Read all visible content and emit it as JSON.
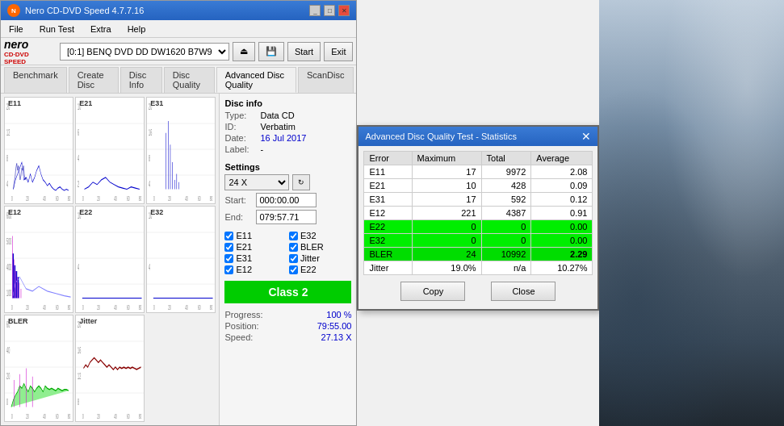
{
  "titleBar": {
    "title": "Nero CD-DVD Speed 4.7.7.16",
    "controls": [
      "minimize",
      "maximize",
      "close"
    ]
  },
  "menu": {
    "items": [
      "File",
      "Run Test",
      "Extra",
      "Help"
    ]
  },
  "toolbar": {
    "logo": "nero",
    "logoSub": "CD·DVD SPEED",
    "driveLabel": "[0:1]  BENQ DVD DD DW1620 B7W9",
    "startLabel": "Start",
    "stopLabel": "Exit"
  },
  "tabs": [
    {
      "label": "Benchmark"
    },
    {
      "label": "Create Disc"
    },
    {
      "label": "Disc Info"
    },
    {
      "label": "Disc Quality"
    },
    {
      "label": "Advanced Disc Quality",
      "active": true
    },
    {
      "label": "ScanDisc"
    }
  ],
  "charts": [
    {
      "id": "E11",
      "label": "E11",
      "maxY": 20
    },
    {
      "id": "E21",
      "label": "E21",
      "maxY": 10
    },
    {
      "id": "E31",
      "label": "E31",
      "maxY": 20
    },
    {
      "id": "E12",
      "label": "E12",
      "maxY": 600
    },
    {
      "id": "E22",
      "label": "E22",
      "maxY": 10
    },
    {
      "id": "E32",
      "label": "E32",
      "maxY": 10
    },
    {
      "id": "BLER",
      "label": "BLER",
      "maxY": 60
    },
    {
      "id": "Jitter",
      "label": "Jitter",
      "maxY": 20
    }
  ],
  "discInfo": {
    "sectionTitle": "Disc info",
    "typeLabel": "Type:",
    "typeValue": "Data CD",
    "idLabel": "ID:",
    "idValue": "Verbatim",
    "dateLabel": "Date:",
    "dateValue": "16 Jul 2017",
    "labelLabel": "Label:",
    "labelValue": "-"
  },
  "settings": {
    "sectionTitle": "Settings",
    "speedValue": "24 X",
    "startLabel": "Start:",
    "startValue": "000:00.00",
    "endLabel": "End:",
    "endValue": "079:57.71"
  },
  "checkboxes": [
    {
      "id": "E11",
      "label": "E11",
      "checked": true
    },
    {
      "id": "E32",
      "label": "E32",
      "checked": true
    },
    {
      "id": "E21",
      "label": "E21",
      "checked": true
    },
    {
      "id": "BLER",
      "label": "BLER",
      "checked": true
    },
    {
      "id": "E31",
      "label": "E31",
      "checked": true
    },
    {
      "id": "Jitter",
      "label": "Jitter",
      "checked": true
    },
    {
      "id": "E12",
      "label": "E12",
      "checked": true
    },
    {
      "id": "E22",
      "label": "E22",
      "checked": true
    }
  ],
  "classBox": {
    "label": "Class 2"
  },
  "progress": {
    "progressLabel": "Progress:",
    "progressValue": "100 %",
    "positionLabel": "Position:",
    "positionValue": "79:55.00",
    "speedLabel": "Speed:",
    "speedValue": "27.13 X"
  },
  "statsDialog": {
    "title": "Advanced Disc Quality Test - Statistics",
    "headers": [
      "Error",
      "Maximum",
      "Total",
      "Average"
    ],
    "rows": [
      {
        "error": "E11",
        "maximum": "17",
        "total": "9972",
        "average": "2.08",
        "highlight": false
      },
      {
        "error": "E21",
        "maximum": "10",
        "total": "428",
        "average": "0.09",
        "highlight": false
      },
      {
        "error": "E31",
        "maximum": "17",
        "total": "592",
        "average": "0.12",
        "highlight": false
      },
      {
        "error": "E12",
        "maximum": "221",
        "total": "4387",
        "average": "0.91",
        "highlight": false
      },
      {
        "error": "E22",
        "maximum": "0",
        "total": "0",
        "average": "0.00",
        "highlight": true,
        "color": "green"
      },
      {
        "error": "E32",
        "maximum": "0",
        "total": "0",
        "average": "0.00",
        "highlight": true,
        "color": "green"
      },
      {
        "error": "BLER",
        "maximum": "24",
        "total": "10992",
        "average": "2.29",
        "highlight": true,
        "color": "greenbler"
      },
      {
        "error": "Jitter",
        "maximum": "19.0%",
        "total": "n/a",
        "average": "10.27%",
        "highlight": false
      }
    ],
    "copyLabel": "Copy",
    "closeLabel": "Close"
  }
}
